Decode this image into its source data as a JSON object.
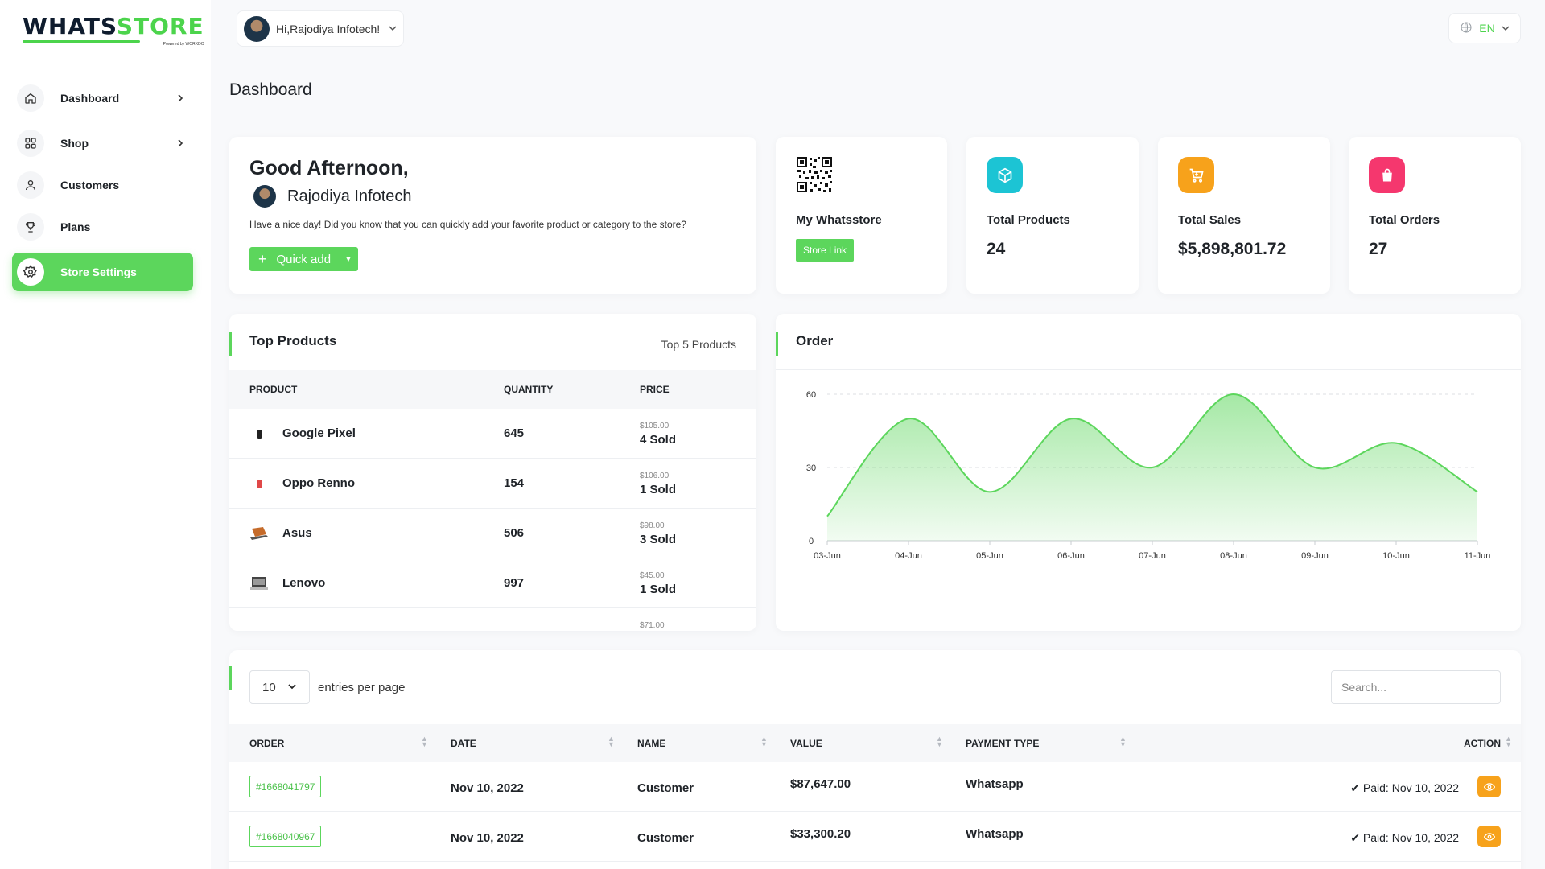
{
  "brand": {
    "logo_part1": "WHATS",
    "logo_part2": "STORE",
    "logo_sub": "Powered by WORKDO"
  },
  "header": {
    "greeting_user": "Hi,Rajodiya Infotech!",
    "language": "EN"
  },
  "sidebar": {
    "items": [
      {
        "label": "Dashboard",
        "icon": "home-icon",
        "has_submenu": true
      },
      {
        "label": "Shop",
        "icon": "grid-icon",
        "has_submenu": true
      },
      {
        "label": "Customers",
        "icon": "user-icon",
        "has_submenu": false
      },
      {
        "label": "Plans",
        "icon": "trophy-icon",
        "has_submenu": false
      },
      {
        "label": "Store Settings",
        "icon": "settings-icon",
        "has_submenu": false,
        "active": true
      }
    ]
  },
  "page": {
    "title": "Dashboard"
  },
  "welcome": {
    "greeting": "Good Afternoon,",
    "name": "Rajodiya Infotech",
    "message": "Have a nice day! Did you know that you can quickly add your favorite product or category to the store?",
    "quick_add_label": "Quick add"
  },
  "stats": {
    "store": {
      "title": "My Whatsstore",
      "link_label": "Store Link"
    },
    "products": {
      "title": "Total Products",
      "value": "24",
      "color": "#1cc4d4"
    },
    "sales": {
      "title": "Total Sales",
      "value": "$5,898,801.72",
      "color": "#f7a21b"
    },
    "orders": {
      "title": "Total Orders",
      "value": "27",
      "color": "#f5376e"
    }
  },
  "top_products": {
    "title": "Top Products",
    "subtitle": "Top 5 Products",
    "columns": [
      "PRODUCT",
      "QUANTITY",
      "PRICE"
    ],
    "rows": [
      {
        "name": "Google Pixel",
        "quantity": "645",
        "price": "$105.00",
        "sold": "4 Sold"
      },
      {
        "name": "Oppo Renno",
        "quantity": "154",
        "price": "$106.00",
        "sold": "1 Sold"
      },
      {
        "name": "Asus",
        "quantity": "506",
        "price": "$98.00",
        "sold": "3 Sold"
      },
      {
        "name": "Lenovo",
        "quantity": "997",
        "price": "$45.00",
        "sold": "1 Sold"
      },
      {
        "name": "",
        "quantity": "",
        "price": "$71.00",
        "sold": ""
      }
    ]
  },
  "order_chart": {
    "title": "Order"
  },
  "chart_data": {
    "type": "area",
    "title": "Order",
    "x": [
      "03-Jun",
      "04-Jun",
      "05-Jun",
      "06-Jun",
      "07-Jun",
      "08-Jun",
      "09-Jun",
      "10-Jun",
      "11-Jun"
    ],
    "series": [
      {
        "values": [
          10,
          50,
          20,
          50,
          30,
          60,
          30,
          40,
          20
        ]
      }
    ],
    "ylim": [
      0,
      60
    ],
    "yticks": [
      0,
      30,
      60
    ],
    "grid": true,
    "color": "#5cd65c"
  },
  "orders_table": {
    "entries_value": "10",
    "entries_label": "entries per page",
    "search_placeholder": "Search...",
    "columns": [
      "ORDER",
      "DATE",
      "NAME",
      "VALUE",
      "PAYMENT TYPE",
      "ACTION"
    ],
    "rows": [
      {
        "order": "#1668041797",
        "date": "Nov 10, 2022",
        "name": "Customer",
        "value": "$87,647.00",
        "payment": "Whatsapp",
        "status": "Paid: Nov 10, 2022"
      },
      {
        "order": "#1668040967",
        "date": "Nov 10, 2022",
        "name": "Customer",
        "value": "$33,300.20",
        "payment": "Whatsapp",
        "status": "Paid: Nov 10, 2022"
      }
    ]
  }
}
